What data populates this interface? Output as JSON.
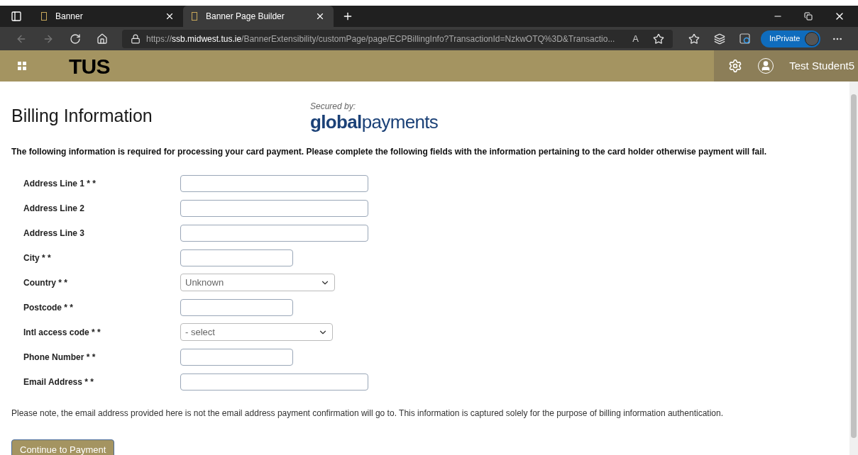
{
  "browser": {
    "tabs": [
      {
        "title": "Banner",
        "selected": false
      },
      {
        "title": "Banner Page Builder",
        "selected": true
      }
    ],
    "address": "https://**ssb.midwest.tus.ie**/BannerExtensibility/customPage/page/ECPBillingInfo?TransactionId=NzkwOTQ%3D&Transactio...",
    "read_aloud": "A",
    "inprivate": "InPrivate"
  },
  "header": {
    "logo": "TUS",
    "user": "Test Student5"
  },
  "page": {
    "title": "Billing Information",
    "secured_by": "Secured by:",
    "provider_logo": "**global**payments",
    "intro": "The following information is required for processing your card payment. Please complete the following fields with the information pertaining to the card holder otherwise payment will fail.",
    "fields": [
      {
        "label": "Address Line 1 * *",
        "kind": "text"
      },
      {
        "label": "Address Line 2",
        "kind": "text"
      },
      {
        "label": "Address Line 3",
        "kind": "text"
      },
      {
        "label": "City * *",
        "kind": "text"
      },
      {
        "label": "Country * *",
        "kind": "select",
        "value": "Unknown"
      },
      {
        "label": "Postcode * *",
        "kind": "text"
      },
      {
        "label": "Intl access code * *",
        "kind": "select",
        "value": "- select"
      },
      {
        "label": "Phone Number * *",
        "kind": "text"
      },
      {
        "label": "Email Address * *",
        "kind": "text"
      }
    ],
    "note": "Please note, the email address provided here is not the email address payment confirmation will go to. This information is captured solely for the purpose of billing information authentication.",
    "submit": "Continue to Payment"
  }
}
